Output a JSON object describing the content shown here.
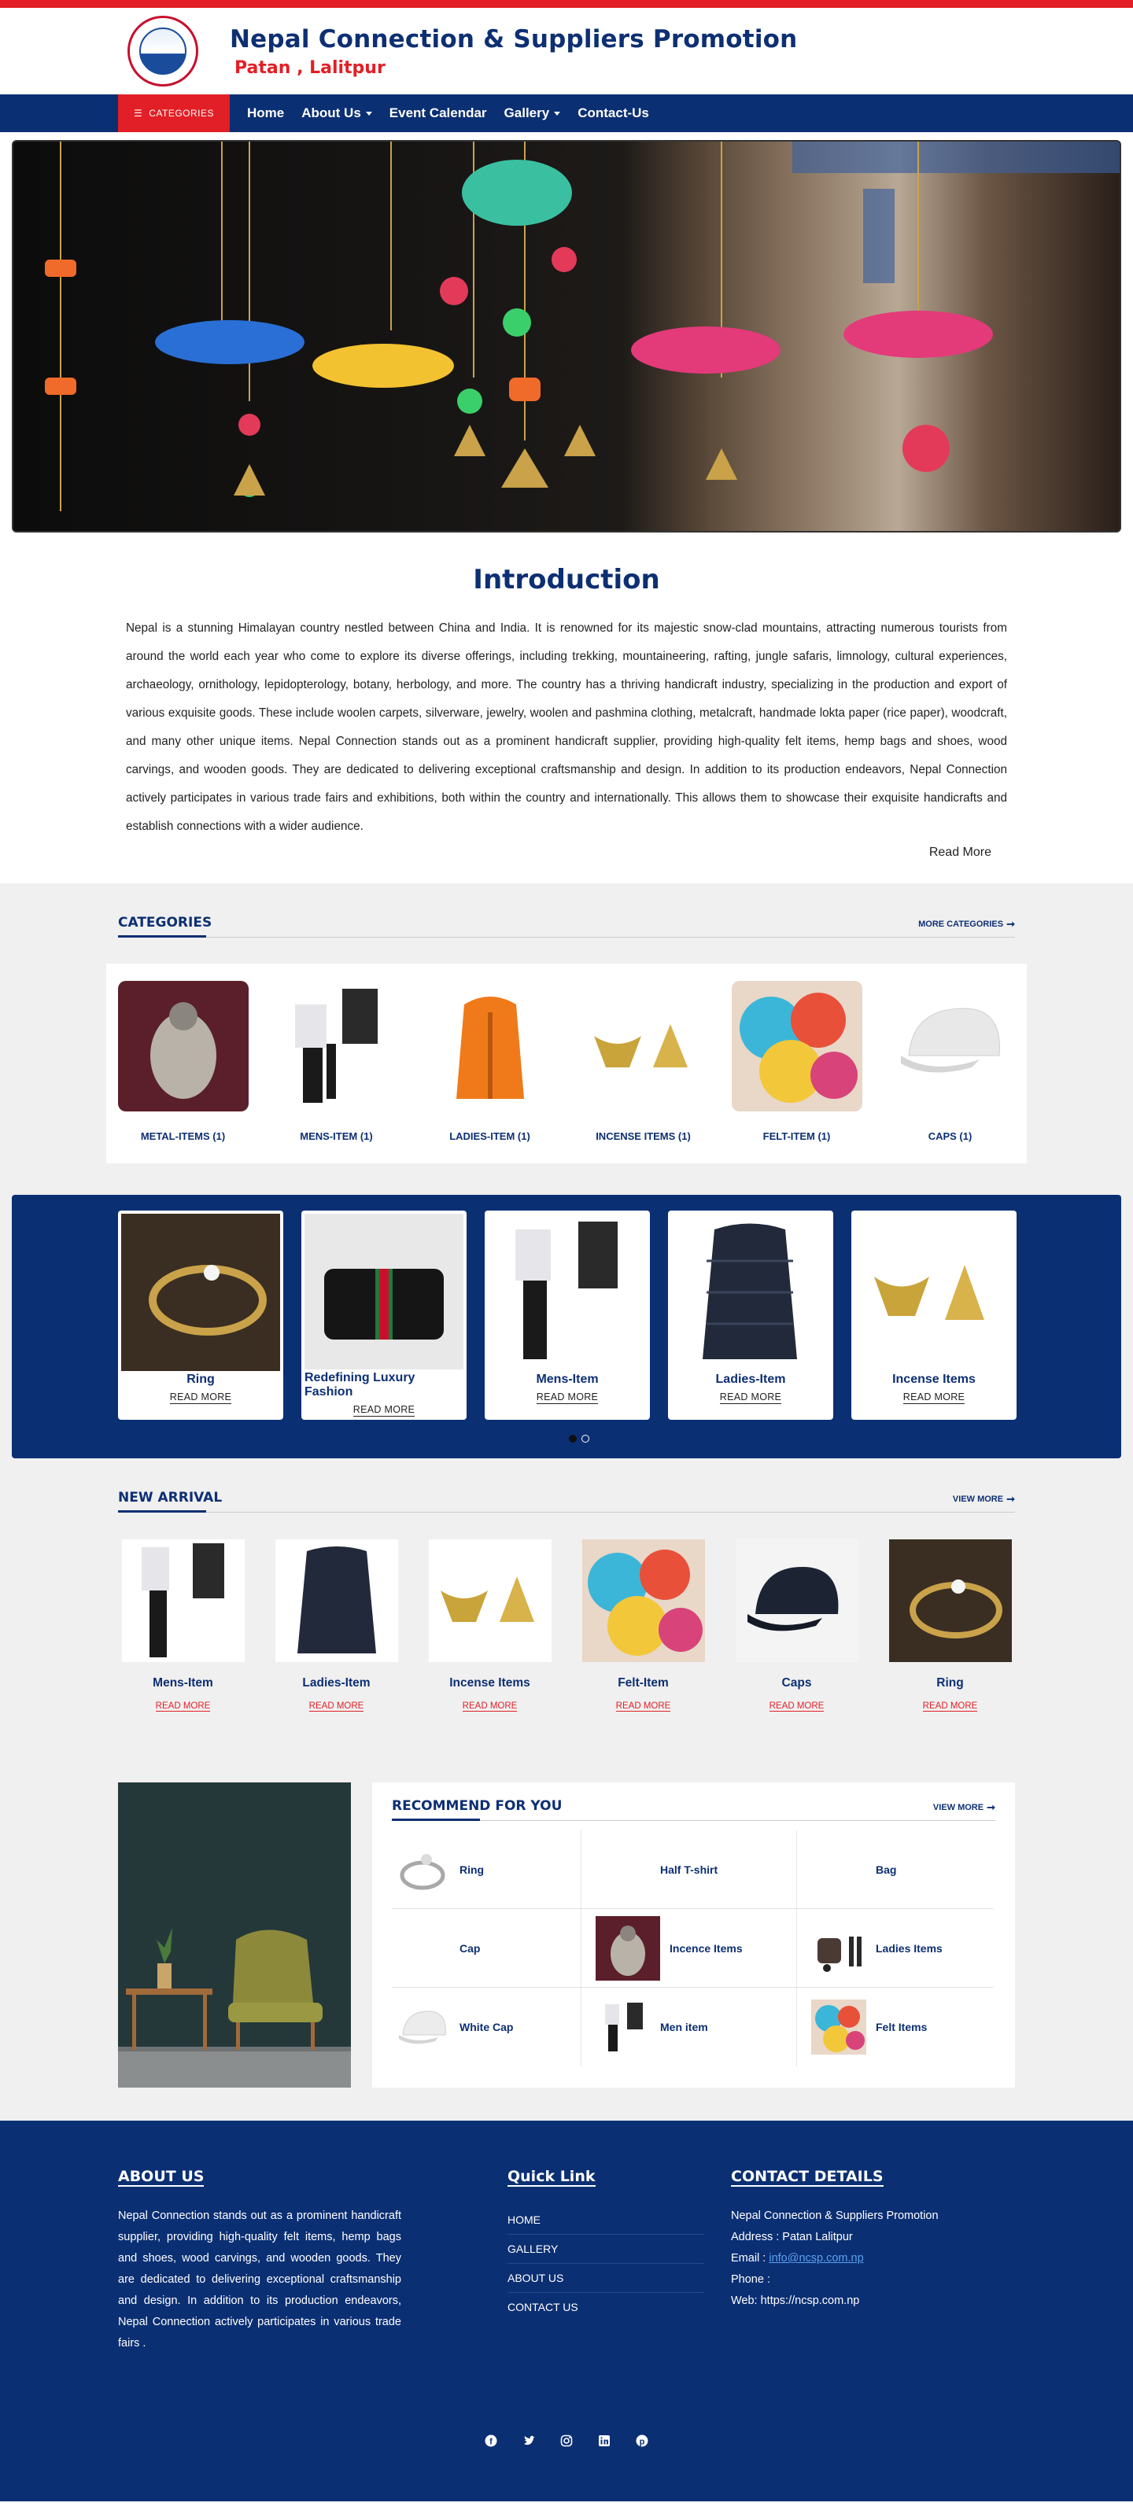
{
  "header": {
    "title": "Nepal Connection & Suppliers Promotion",
    "subtitle": "Patan , Lalitpur"
  },
  "nav": {
    "categories_label": "CATEGORIES",
    "items": [
      {
        "label": "Home"
      },
      {
        "label": "About Us"
      },
      {
        "label": "Event Calendar"
      },
      {
        "label": "Gallery"
      },
      {
        "label": "Contact-Us"
      }
    ]
  },
  "intro": {
    "heading": "Introduction",
    "text": "Nepal is a stunning Himalayan country nestled between China and India. It is renowned for its majestic snow-clad mountains, attracting numerous tourists from around the world each year who come to explore its diverse offerings, including trekking, mountaineering, rafting, jungle safaris, limnology, cultural experiences, archaeology, ornithology, lepidopterology, botany, herbology, and more. The country has a thriving handicraft industry, specializing in the production and export of various exquisite goods. These include woolen carpets, silverware, jewelry, woolen and pashmina clothing, metalcraft, handmade lokta paper (rice paper), woodcraft, and many other unique items. Nepal Connection stands out as a prominent handicraft supplier, providing high-quality felt items, hemp bags and shoes, wood carvings, and wooden goods. They are dedicated to delivering exceptional craftsmanship and design. In addition to its production endeavors, Nepal Connection actively participates in various trade fairs and exhibitions, both within the country and internationally. This allows them to showcase their exquisite handicrafts and establish connections with a wider audience.",
    "read_more": "Read More"
  },
  "categories": {
    "heading": "CATEGORIES",
    "more": "MORE CATEGORIES",
    "items": [
      {
        "label": "METAL-ITEMS (1)"
      },
      {
        "label": "MENS-ITEM (1)"
      },
      {
        "label": "LADIES-ITEM (1)"
      },
      {
        "label": "INCENSE ITEMS (1)"
      },
      {
        "label": "FELT-ITEM (1)"
      },
      {
        "label": "CAPS (1)"
      }
    ]
  },
  "slider": {
    "items": [
      {
        "title": "Ring",
        "button": "READ MORE"
      },
      {
        "title": "Redefining Luxury Fashion",
        "button": "READ MORE"
      },
      {
        "title": "Mens-Item",
        "button": "READ MORE"
      },
      {
        "title": "Ladies-Item",
        "button": "READ MORE"
      },
      {
        "title": "Incense Items",
        "button": "READ MORE"
      }
    ]
  },
  "new_arrival": {
    "heading": "NEW ARRIVAL",
    "more": "VIEW MORE",
    "items": [
      {
        "title": "Mens-Item",
        "button": "READ MORE"
      },
      {
        "title": "Ladies-Item",
        "button": "READ MORE"
      },
      {
        "title": "Incense Items",
        "button": "READ MORE"
      },
      {
        "title": "Felt-Item",
        "button": "READ MORE"
      },
      {
        "title": "Caps",
        "button": "READ MORE"
      },
      {
        "title": "Ring",
        "button": "READ MORE"
      }
    ]
  },
  "recommend": {
    "heading": "RECOMMEND FOR YOU",
    "more": "VIEW MORE",
    "items": [
      {
        "name": "Ring"
      },
      {
        "name": "Half T-shirt"
      },
      {
        "name": "Bag"
      },
      {
        "name": "Cap"
      },
      {
        "name": "Incence Items"
      },
      {
        "name": "Ladies Items"
      },
      {
        "name": "White Cap"
      },
      {
        "name": "Men item"
      },
      {
        "name": "Felt Items"
      }
    ]
  },
  "footer": {
    "about_heading": "ABOUT US",
    "about_text": "Nepal Connection stands out as a prominent handicraft supplier, providing high-quality felt items, hemp bags and shoes, wood carvings, and wooden goods. They are dedicated to delivering exceptional craftsmanship and design. In addition to its production endeavors, Nepal Connection actively participates in various trade fairs .",
    "links_heading": "Quick Link",
    "links": [
      {
        "label": "HOME"
      },
      {
        "label": "GALLERY"
      },
      {
        "label": "ABOUT US"
      },
      {
        "label": "CONTACT US"
      }
    ],
    "contact_heading": "CONTACT DETAILS",
    "company": "Nepal Connection & Suppliers Promotion",
    "address": "Address : Patan Lalitpur",
    "email_label": "Email : ",
    "email": "info@ncsp.com.np",
    "phone": "Phone :",
    "web": "Web: https://ncsp.com.np",
    "social": [
      "facebook-icon",
      "twitter-icon",
      "instagram-icon",
      "linkedin-icon",
      "pinterest-icon"
    ]
  },
  "colors": {
    "brand_blue": "#0b2f73",
    "accent_red": "#e21f26"
  }
}
